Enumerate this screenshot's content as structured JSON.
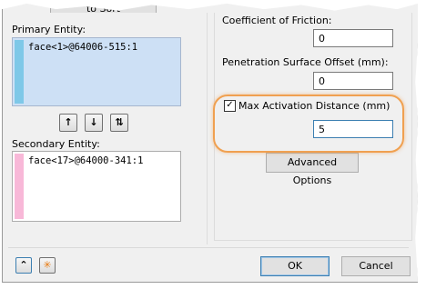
{
  "top_button": {
    "label": "to Sort"
  },
  "primary": {
    "label": "Primary Entity:",
    "entity_text": "face<1>@64006-515:1",
    "swatch_color": "#7ec8e8",
    "buttons": [
      {
        "symbol": "↑",
        "name": "move-up-icon"
      },
      {
        "symbol": "↓",
        "name": "move-down-icon"
      },
      {
        "symbol": "⇅",
        "name": "swap-icon"
      }
    ]
  },
  "secondary": {
    "label": "Secondary Entity:",
    "entity_text": "face<17>@64000-341:1",
    "swatch_color": "#f8b8d8"
  },
  "friction": {
    "label": "Coefficient of Friction:",
    "value": "0"
  },
  "penetration": {
    "label": "Penetration Surface Offset (mm):",
    "value": "0"
  },
  "max_activation": {
    "label": "Max Activation Distance (mm)",
    "checked": true,
    "value": "5"
  },
  "advanced_button": {
    "label": "Advanced Options"
  },
  "footer": {
    "collapse_symbol": "⌃",
    "reset_symbol": "✳",
    "ok_label": "OK",
    "cancel_label": "Cancel"
  },
  "colors": {
    "highlight": "#f0a050",
    "selected_bg": "#cde0f5",
    "focus_border": "#3c7fb1"
  }
}
